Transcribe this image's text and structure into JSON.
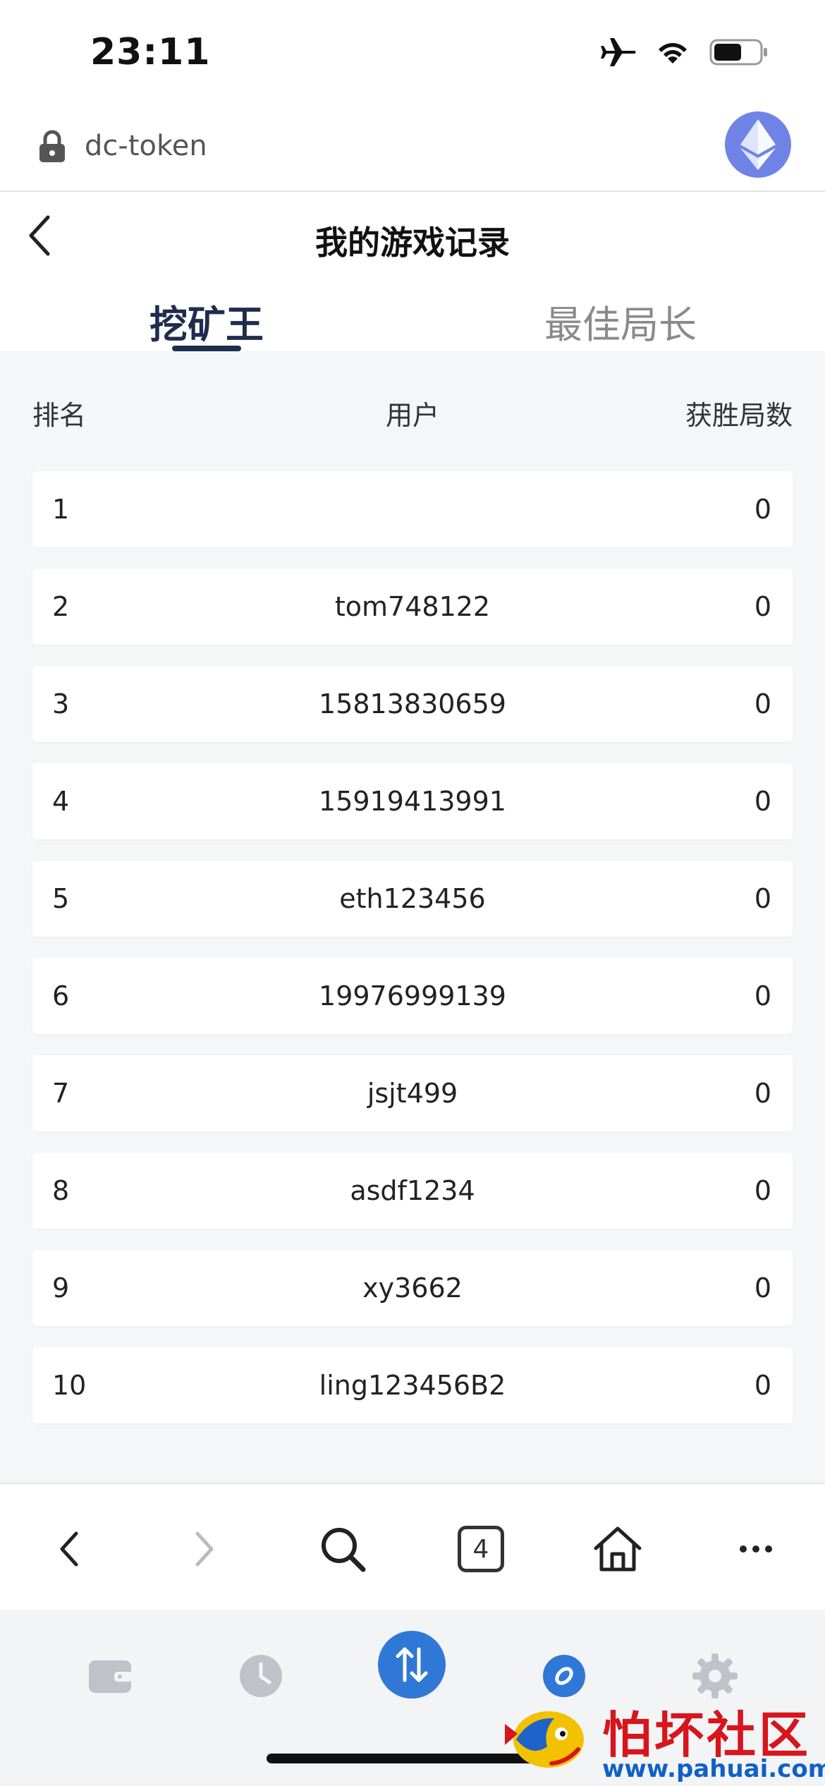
{
  "status_bar": {
    "time": "23:11"
  },
  "address_bar": {
    "text": "dc-token"
  },
  "header": {
    "title": "我的游戏记录"
  },
  "tabs": [
    {
      "label": "挖矿王",
      "active": true
    },
    {
      "label": "最佳局长",
      "active": false
    }
  ],
  "table": {
    "columns": {
      "rank": "排名",
      "user": "用户",
      "wins": "获胜局数"
    },
    "rows": [
      {
        "rank": "1",
        "user": "",
        "wins": "0"
      },
      {
        "rank": "2",
        "user": "tom748122",
        "wins": "0"
      },
      {
        "rank": "3",
        "user": "15813830659",
        "wins": "0"
      },
      {
        "rank": "4",
        "user": "15919413991",
        "wins": "0"
      },
      {
        "rank": "5",
        "user": "eth123456",
        "wins": "0"
      },
      {
        "rank": "6",
        "user": "19976999139",
        "wins": "0"
      },
      {
        "rank": "7",
        "user": "jsjt499",
        "wins": "0"
      },
      {
        "rank": "8",
        "user": "asdf1234",
        "wins": "0"
      },
      {
        "rank": "9",
        "user": "xy3662",
        "wins": "0"
      },
      {
        "rank": "10",
        "user": "ling123456B2",
        "wins": "0"
      }
    ]
  },
  "browser_toolbar": {
    "tab_count": "4",
    "icons": [
      "back-icon",
      "forward-icon",
      "search-icon",
      "tabs-icon",
      "home-icon",
      "more-icon"
    ]
  },
  "app_tabbar": {
    "icons": [
      "wallet-icon",
      "clock-icon",
      "swap-icon",
      "compass-icon",
      "gear-icon"
    ],
    "active": "swap-icon"
  },
  "watermark": {
    "title": "怕坏社区",
    "url": "www.pahuai.com"
  },
  "colors": {
    "accent_navy": "#1f2d4d",
    "swap_blue": "#2f78d6",
    "eth_purple": "#6f84e6",
    "watermark_red": "#d8141c",
    "watermark_blue": "#1060c8"
  }
}
